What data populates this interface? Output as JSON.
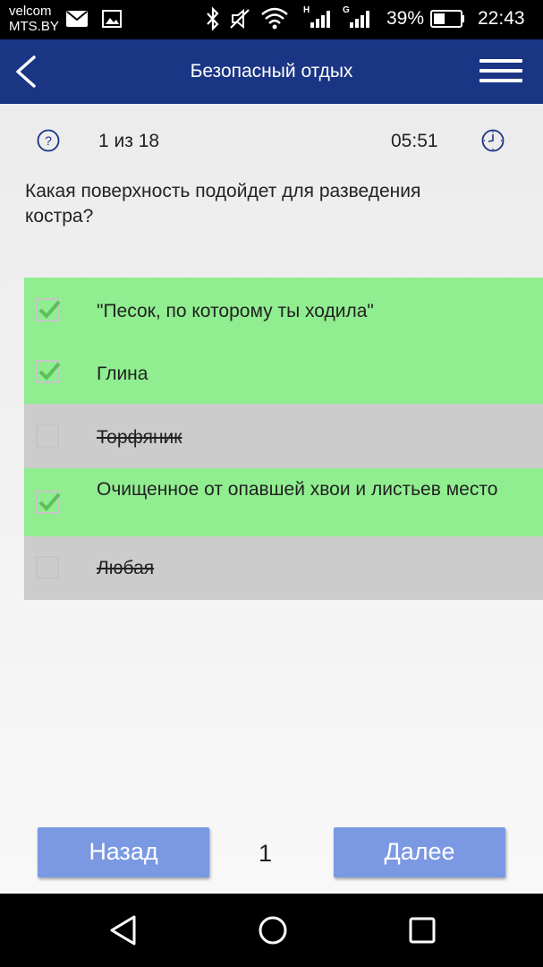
{
  "status_bar": {
    "carrier_1": "velcom",
    "carrier_2": "MTS.BY",
    "network_1": "H",
    "network_2": "G",
    "battery": "39%",
    "time": "22:43"
  },
  "app_bar": {
    "title": "Безопасный отдых"
  },
  "quiz": {
    "counter": "1 из 18",
    "timer": "05:51",
    "question": "Какая поверхность подойдет для разведения костра?",
    "answers": [
      {
        "label": "\"Песок, по которому ты ходила\"",
        "checked": true,
        "state": "correct"
      },
      {
        "label": "Глина",
        "checked": true,
        "state": "correct"
      },
      {
        "label": "Торфяник",
        "checked": false,
        "state": "wrong"
      },
      {
        "label": "Очищенное от опавшей хвои и листьев место",
        "checked": true,
        "state": "correct"
      },
      {
        "label": "Любая",
        "checked": false,
        "state": "wrong"
      }
    ]
  },
  "footer": {
    "back_label": "Назад",
    "next_label": "Далее",
    "page_number": "1"
  },
  "colors": {
    "app_bar": "#1b3585",
    "correct": "#90ee90",
    "wrong": "#cccccc",
    "button": "#7b98e3"
  },
  "icons": [
    "back-arrow-icon",
    "menu-icon",
    "help-icon",
    "clock-icon",
    "checkmark-icon",
    "back-triangle-icon",
    "home-circle-icon",
    "recents-square-icon"
  ]
}
